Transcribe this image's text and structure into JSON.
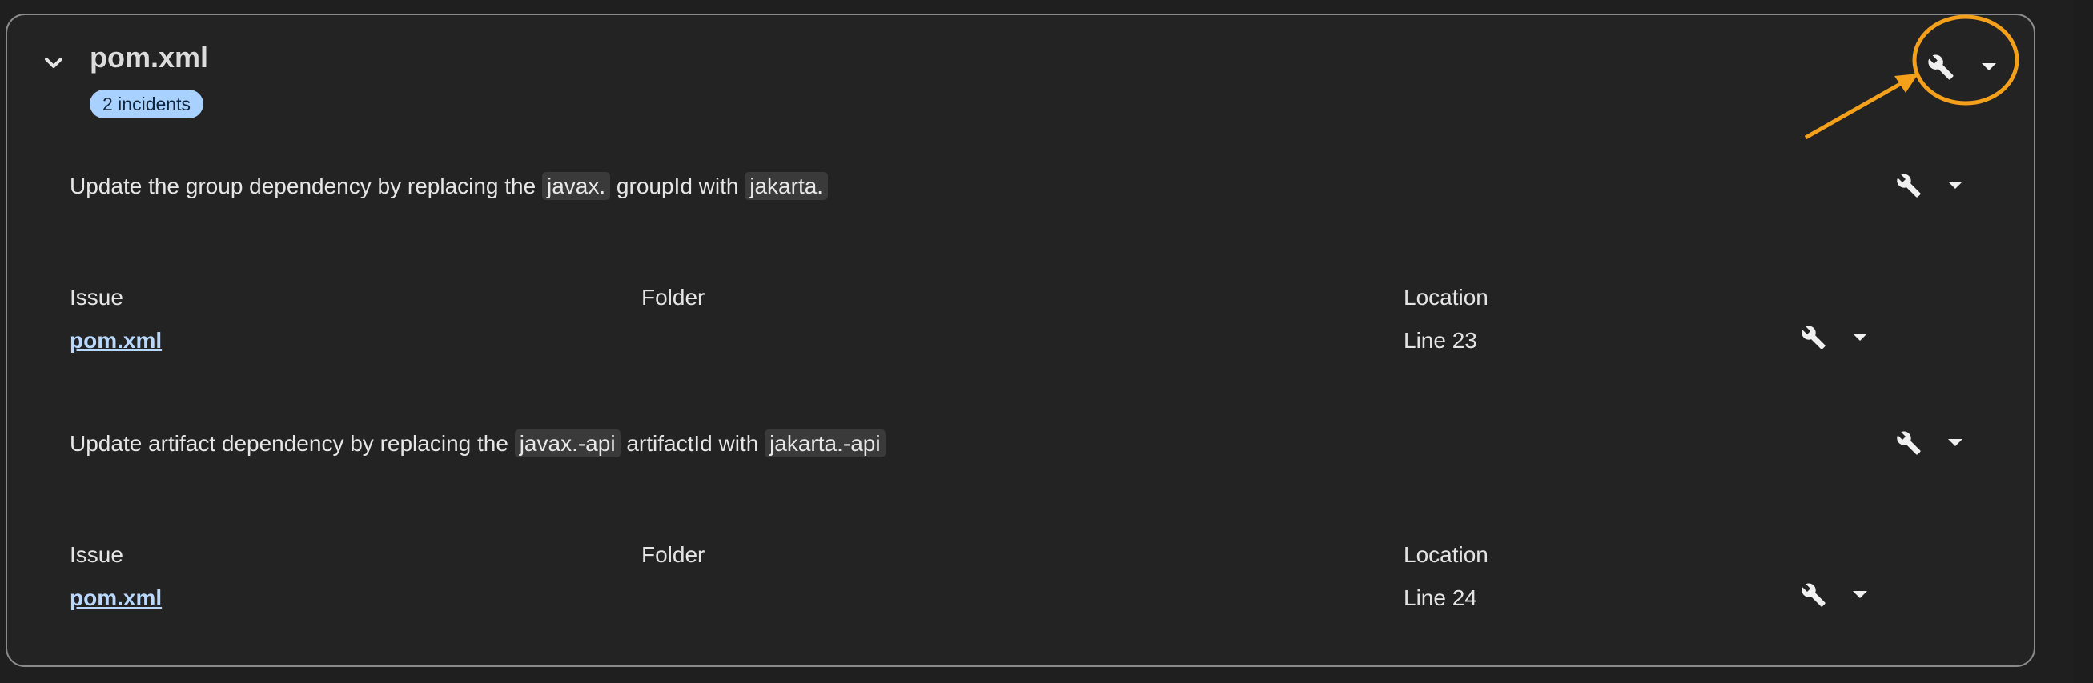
{
  "file": {
    "title": "pom.xml",
    "badge": "2 incidents",
    "icons": {
      "collapse": "chevron-down-icon",
      "fix": "wrench-icon",
      "menu": "caret-down-icon"
    }
  },
  "annotation": {
    "color": "#f5a01a"
  },
  "rules": [
    {
      "text_parts": [
        "Update the group dependency by replacing the ",
        "javax.",
        " groupId with ",
        "jakarta."
      ],
      "columns": [
        "Issue",
        "Folder",
        "Location"
      ],
      "row": {
        "issue": "pom.xml",
        "folder": "",
        "location": "Line 23"
      }
    },
    {
      "text_parts": [
        "Update artifact dependency by replacing the ",
        "javax.-api",
        " artifactId with ",
        "jakarta.-api"
      ],
      "columns": [
        "Issue",
        "Folder",
        "Location"
      ],
      "row": {
        "issue": "pom.xml",
        "folder": "",
        "location": "Line 24"
      }
    }
  ]
}
